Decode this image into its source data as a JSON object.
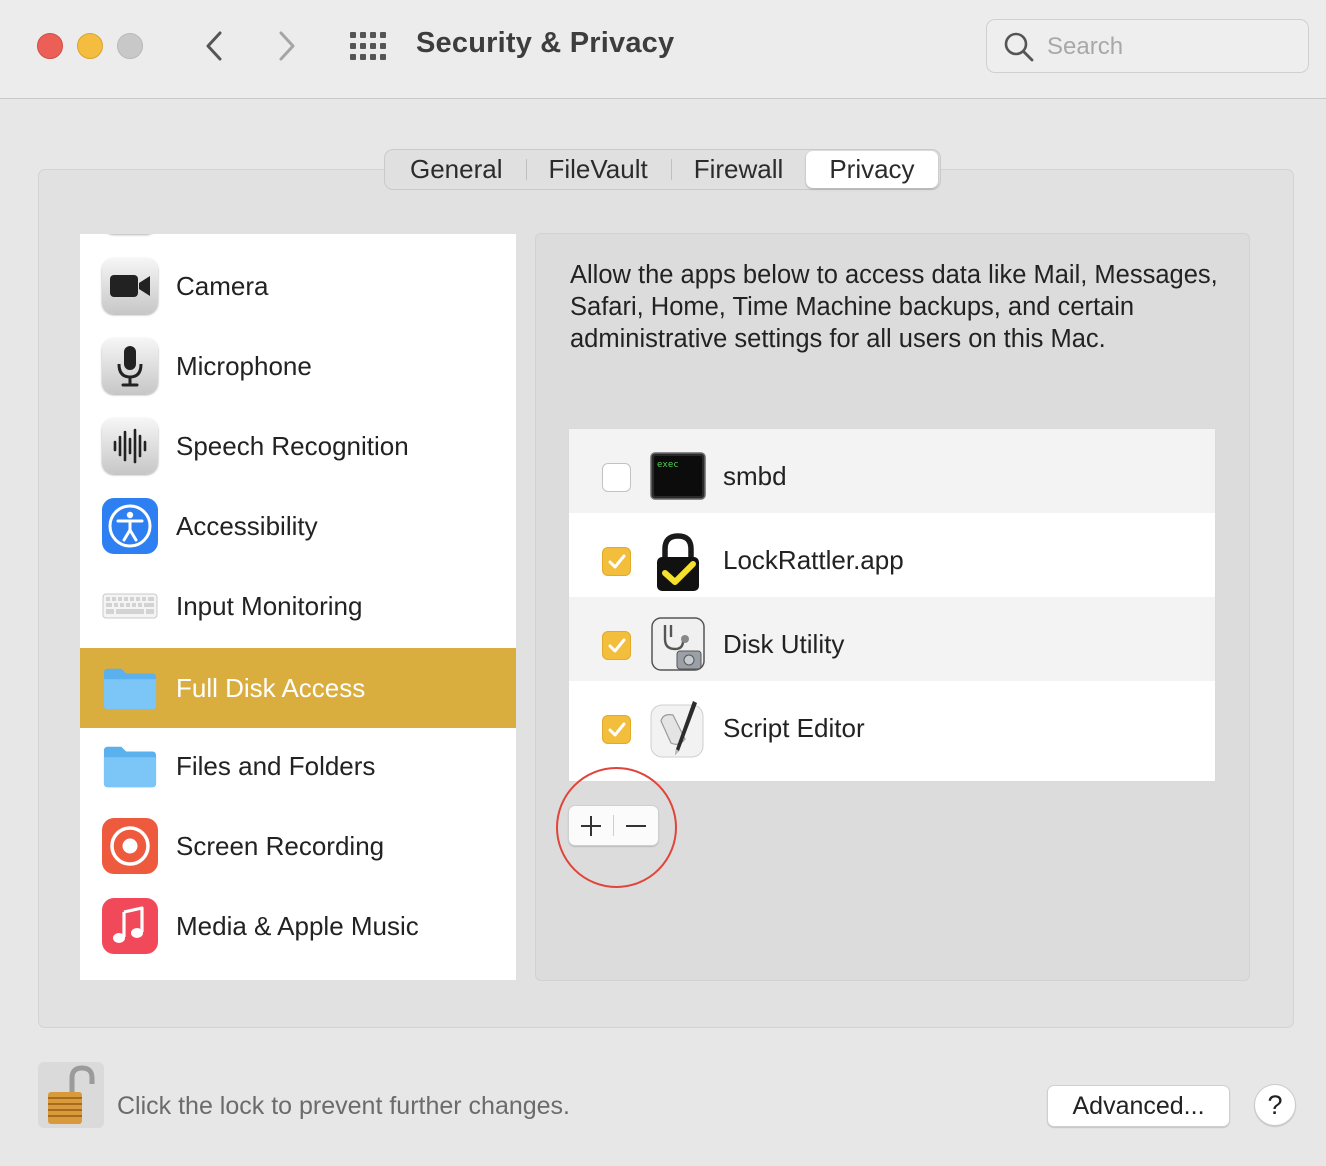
{
  "window": {
    "title": "Security & Privacy",
    "search_placeholder": "Search"
  },
  "tabs": [
    {
      "label": "General",
      "active": false
    },
    {
      "label": "FileVault",
      "active": false
    },
    {
      "label": "Firewall",
      "active": false
    },
    {
      "label": "Privacy",
      "active": true
    }
  ],
  "sidebar": {
    "items": [
      {
        "label": "Camera",
        "icon": "camera-icon"
      },
      {
        "label": "Microphone",
        "icon": "microphone-icon"
      },
      {
        "label": "Speech Recognition",
        "icon": "waveform-icon"
      },
      {
        "label": "Accessibility",
        "icon": "accessibility-icon"
      },
      {
        "label": "Input Monitoring",
        "icon": "keyboard-icon"
      },
      {
        "label": "Full Disk Access",
        "icon": "folder-icon",
        "selected": true
      },
      {
        "label": "Files and Folders",
        "icon": "folder-icon"
      },
      {
        "label": "Screen Recording",
        "icon": "screen-recording-icon"
      },
      {
        "label": "Media & Apple Music",
        "icon": "music-note-icon"
      }
    ]
  },
  "main": {
    "description": "Allow the apps below to access data like Mail, Messages, Safari, Home, Time Machine backups, and certain administrative settings for all users on this Mac.",
    "apps": [
      {
        "name": "smbd",
        "checked": false,
        "icon": "terminal-exec-icon",
        "icon_text": "exec"
      },
      {
        "name": "LockRattler.app",
        "checked": true,
        "icon": "padlock-check-icon"
      },
      {
        "name": "Disk Utility",
        "checked": true,
        "icon": "disk-utility-icon"
      },
      {
        "name": "Script Editor",
        "checked": true,
        "icon": "script-editor-icon"
      }
    ],
    "add_label": "+",
    "remove_label": "−"
  },
  "footer": {
    "lock_text": "Click the lock to prevent further changes.",
    "advanced_label": "Advanced...",
    "help_label": "?"
  },
  "colors": {
    "selection": "#d9ae3f",
    "checkbox": "#f2be3b",
    "annotation": "#e0443a"
  }
}
